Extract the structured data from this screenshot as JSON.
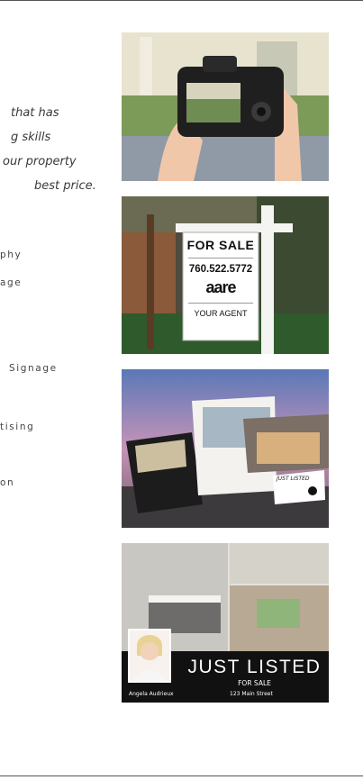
{
  "tagline": {
    "lines": [
      "that has",
      "g skills",
      "our property",
      "best price."
    ]
  },
  "services": [
    "phy",
    "age",
    "Signage",
    "tising",
    "on"
  ],
  "photos": {
    "camera": {
      "icon": "camera-photo"
    },
    "sign": {
      "heading": "FOR SALE",
      "phone": "760.522.5772",
      "logo": "aare",
      "agent": "YOUR AGENT"
    },
    "flyers": {
      "icon": "listing-flyers",
      "small_card_text": "JUST LISTED"
    },
    "listing": {
      "headline": "JUST LISTED",
      "subhead": "FOR SALE",
      "agent_name": "Angela Audrieux",
      "address": "123 Main Street"
    }
  },
  "colors": {
    "divider": "#555555",
    "text": "#333333",
    "banner": "#111111"
  }
}
